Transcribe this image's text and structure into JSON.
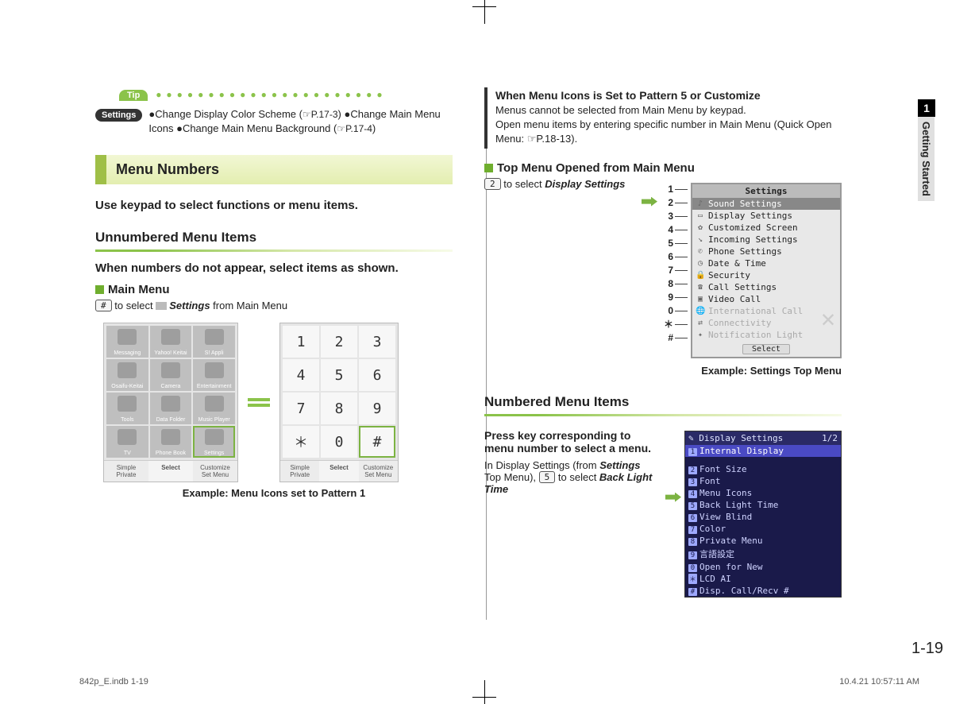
{
  "side_tab": {
    "chapter": "1",
    "label": "Getting Started"
  },
  "tip": {
    "badge": "Tip",
    "settings_badge": "Settings",
    "line1_a": "●Change Display Color Scheme (",
    "line1_ref": "☞P.17-3",
    "line1_b": ") ●Change Main Menu Icons ●Change Main Menu Background (",
    "line1_ref2": "☞P.17-4",
    "line1_c": ")"
  },
  "section_heading": "Menu Numbers",
  "lead": "Use keypad to select functions or menu items.",
  "sub1": "Unnumbered Menu Items",
  "sub1_lead": "When numbers do not appear, select items as shown.",
  "main_menu": {
    "heading": "Main Menu",
    "key": "#",
    "text_a": " to select ",
    "settings_word": "Settings",
    "text_b": " from Main Menu"
  },
  "phone_grid_labels": [
    "Messaging",
    "Yahoo! Keitai",
    "S! Appli",
    "Osaifu-Keitai",
    "Camera",
    "Entertainment",
    "Tools",
    "Data Folder",
    "Music Player",
    "TV",
    "Phone Book",
    "Settings"
  ],
  "pg_bottom": {
    "l1": "Simple",
    "l2": "Private",
    "mid": "Select",
    "r1": "Customize",
    "r2": "Set Menu"
  },
  "keypad": [
    "1",
    "2",
    "3",
    "4",
    "5",
    "6",
    "7",
    "8",
    "9",
    "＊",
    "0",
    "#"
  ],
  "caption1": "Example: Menu Icons set to Pattern 1",
  "note": {
    "title": "When Menu Icons is Set to Pattern 5 or Customize",
    "l1": "Menus cannot be selected from Main Menu by keypad.",
    "l2a": "Open menu items by entering specific number in Main Menu (Quick Open Menu: ",
    "l2ref": "☞P.18-13",
    "l2b": ")."
  },
  "top_menu": {
    "heading": "Top Menu Opened from Main Menu",
    "key": "2",
    "text_a": " to select ",
    "target": "Display Settings"
  },
  "settings_list": {
    "header": "Settings",
    "keys": [
      "1",
      "2",
      "3",
      "4",
      "5",
      "6",
      "7",
      "8",
      "9",
      "0",
      "＊",
      "#"
    ],
    "items": [
      "Sound Settings",
      "Display Settings",
      "Customized Screen",
      "Incoming Settings",
      "Phone Settings",
      "Date & Time",
      "Security",
      "Call Settings",
      "Video Call",
      "International Call",
      "Connectivity",
      "Notification Light"
    ],
    "select_btn": "Select",
    "caption": "Example: Settings Top Menu"
  },
  "sub2": "Numbered Menu Items",
  "numbered": {
    "lead": "Press key corresponding to menu number to select a menu.",
    "body_a": "In Display Settings (from ",
    "body_settings": "Settings",
    "body_b": " Top Menu), ",
    "key": "5",
    "body_c": " to select ",
    "target": "Back Light Time"
  },
  "dark_list": {
    "header_l": "Display Settings",
    "header_r": "1/2",
    "items": [
      "Internal Display",
      "Font Size",
      "Font",
      "Menu Icons",
      "Back Light Time",
      "View Blind",
      "Color",
      "Private Menu",
      "言語設定",
      "Open for New",
      "LCD AI",
      "Disp. Call/Recv #"
    ],
    "nums": [
      "1",
      "2",
      "3",
      "4",
      "5",
      "6",
      "7",
      "8",
      "9",
      "0",
      "＊",
      "#"
    ]
  },
  "page_number": "1-19",
  "footer_left": "842p_E.indb   1-19",
  "footer_right": "10.4.21   10:57:11 AM"
}
